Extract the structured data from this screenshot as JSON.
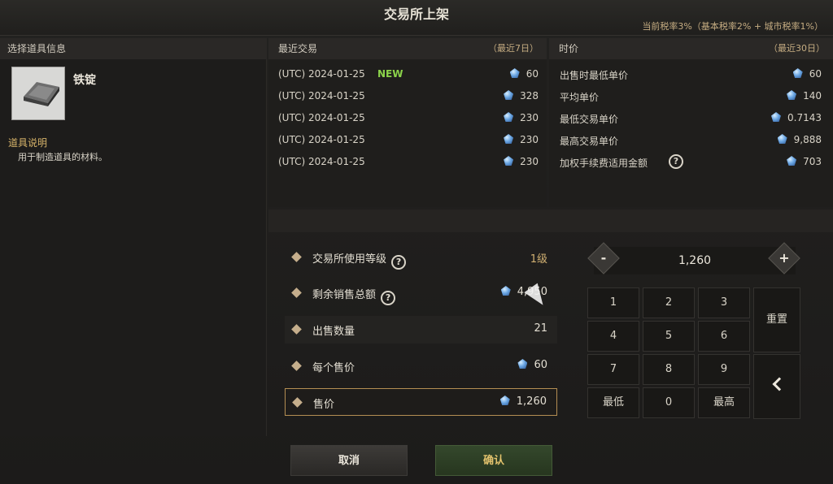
{
  "window": {
    "title": "交易所上架",
    "tax_note": "当前税率3%（基本税率2% + 城市税率1%）"
  },
  "left_panel": {
    "header": "选择道具信息",
    "item_name": "铁锭",
    "desc_header": "道具说明",
    "desc_text": "用于制造道具的材料。"
  },
  "recent_trades": {
    "header": "最近交易",
    "range": "（最近7日）",
    "rows": [
      {
        "date": "(UTC) 2024-01-25",
        "badge": "NEW",
        "amount": "60"
      },
      {
        "date": "(UTC) 2024-01-25",
        "badge": "",
        "amount": "328"
      },
      {
        "date": "(UTC) 2024-01-25",
        "badge": "",
        "amount": "230"
      },
      {
        "date": "(UTC) 2024-01-25",
        "badge": "",
        "amount": "230"
      },
      {
        "date": "(UTC) 2024-01-25",
        "badge": "",
        "amount": "230"
      }
    ]
  },
  "market_price": {
    "header": "时价",
    "range": "（最近30日）",
    "rows": [
      {
        "label": "出售时最低单价",
        "amount": "60"
      },
      {
        "label": "平均单价",
        "amount": "140"
      },
      {
        "label": "最低交易单价",
        "amount": "0.7143"
      },
      {
        "label": "最高交易单价",
        "amount": "9,888"
      },
      {
        "label": "加权手续费适用金额",
        "amount": "703"
      }
    ]
  },
  "form": {
    "level_label": "交易所使用等级",
    "level_value": "1级",
    "remaining_label": "剩余销售总额",
    "remaining_value": "4,950",
    "qty_label": "出售数量",
    "qty_value": "21",
    "unit_label": "每个售价",
    "unit_value": "60",
    "total_label": "售价",
    "total_value": "1,260"
  },
  "keypad": {
    "display": "1,260",
    "minus": "-",
    "plus": "+",
    "keys": [
      "1",
      "2",
      "3",
      "4",
      "5",
      "6",
      "7",
      "8",
      "9",
      "最低",
      "0",
      "最高"
    ],
    "reset": "重置"
  },
  "buttons": {
    "cancel": "取消",
    "confirm": "确认"
  }
}
